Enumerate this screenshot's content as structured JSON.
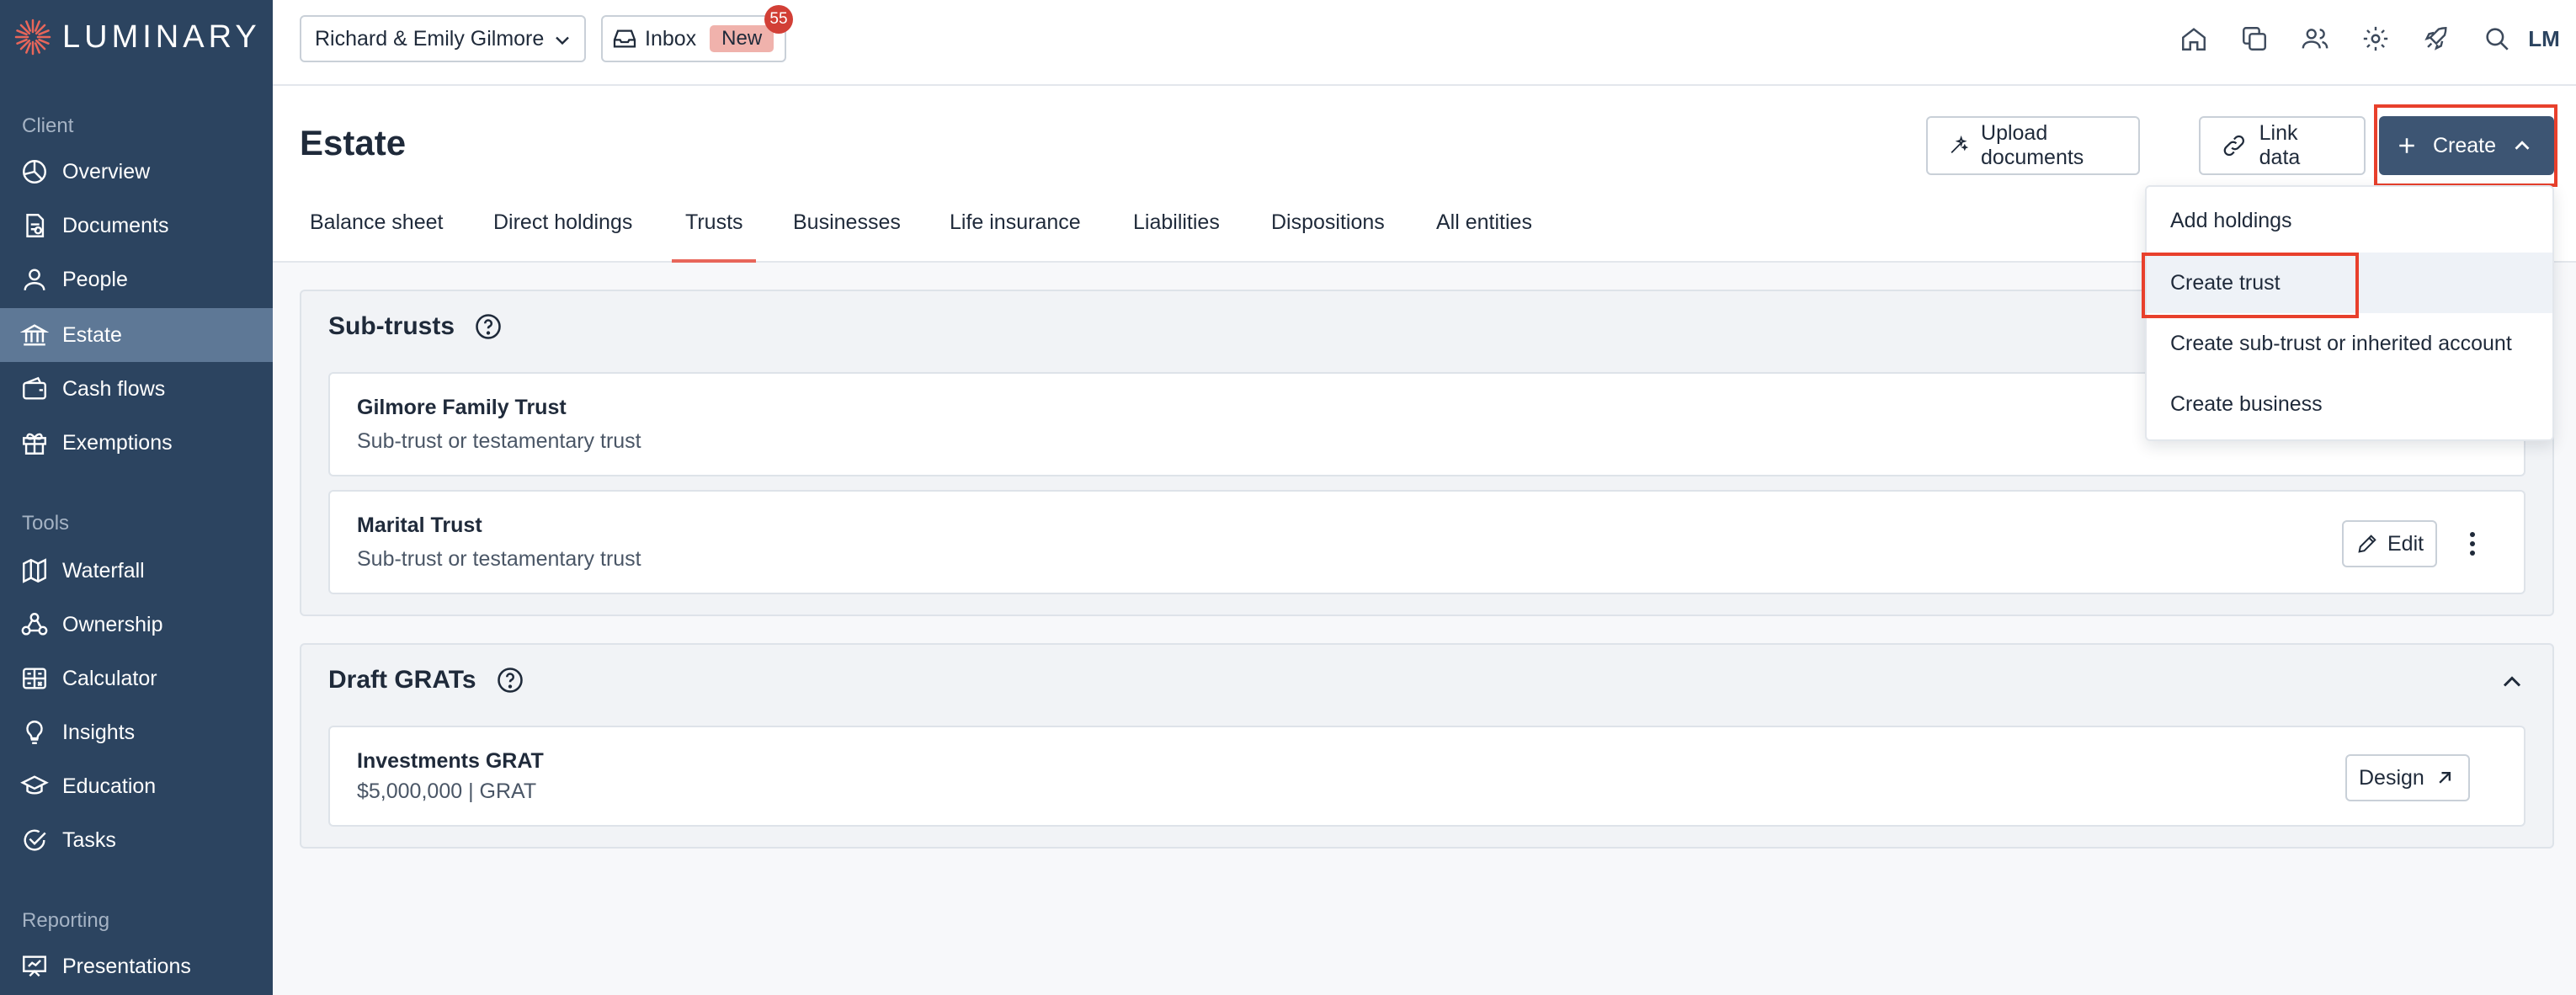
{
  "brand": {
    "name": "LUMINARY"
  },
  "sidebar": {
    "sections": [
      {
        "label": "Client"
      },
      {
        "label": "Tools"
      },
      {
        "label": "Reporting"
      }
    ],
    "items": [
      {
        "label": "Overview",
        "icon": "overview-icon"
      },
      {
        "label": "Documents",
        "icon": "documents-icon"
      },
      {
        "label": "People",
        "icon": "person-icon"
      },
      {
        "label": "Estate",
        "icon": "bank-icon",
        "active": true
      },
      {
        "label": "Cash flows",
        "icon": "wallet-icon"
      },
      {
        "label": "Exemptions",
        "icon": "gift-icon"
      },
      {
        "label": "Waterfall",
        "icon": "map-icon"
      },
      {
        "label": "Ownership",
        "icon": "hierarchy-icon"
      },
      {
        "label": "Calculator",
        "icon": "calculator-icon"
      },
      {
        "label": "Insights",
        "icon": "lightbulb-icon"
      },
      {
        "label": "Education",
        "icon": "graduation-cap-icon"
      },
      {
        "label": "Tasks",
        "icon": "check-circle-icon"
      },
      {
        "label": "Presentations",
        "icon": "presentation-icon"
      }
    ]
  },
  "topbar": {
    "client": "Richard & Emily Gilmore",
    "inbox_label": "Inbox",
    "inbox_badge": "New",
    "inbox_count": "55",
    "avatar": "LM"
  },
  "header": {
    "title": "Estate",
    "upload_label": "Upload documents",
    "link_label": "Link data",
    "create_label": "Create"
  },
  "tabs": [
    {
      "label": "Balance sheet"
    },
    {
      "label": "Direct holdings"
    },
    {
      "label": "Trusts",
      "active": true
    },
    {
      "label": "Businesses"
    },
    {
      "label": "Life insurance"
    },
    {
      "label": "Liabilities"
    },
    {
      "label": "Dispositions"
    },
    {
      "label": "All entities"
    }
  ],
  "subtrusts": {
    "title": "Sub-trusts",
    "rows": [
      {
        "name": "Gilmore Family Trust",
        "type": "Sub-trust or testamentary trust"
      },
      {
        "name": "Marital Trust",
        "type": "Sub-trust or testamentary trust"
      }
    ],
    "edit_label": "Edit"
  },
  "grats": {
    "title": "Draft GRATs",
    "rows": [
      {
        "name": "Investments GRAT",
        "detail": "$5,000,000 | GRAT",
        "action": "Design"
      }
    ]
  },
  "create_menu": {
    "items": [
      {
        "label": "Add holdings"
      },
      {
        "label": "Create trust",
        "highlighted": true
      },
      {
        "label": "Create sub-trust or inherited account"
      },
      {
        "label": "Create business"
      }
    ]
  },
  "colors": {
    "sidebar_bg": "#2c4460",
    "sidebar_active": "#5e7896",
    "primary_button": "#3d5573",
    "highlight_box": "#e8402c",
    "tab_underline": "#e8665a",
    "badge_red": "#d23f36"
  }
}
